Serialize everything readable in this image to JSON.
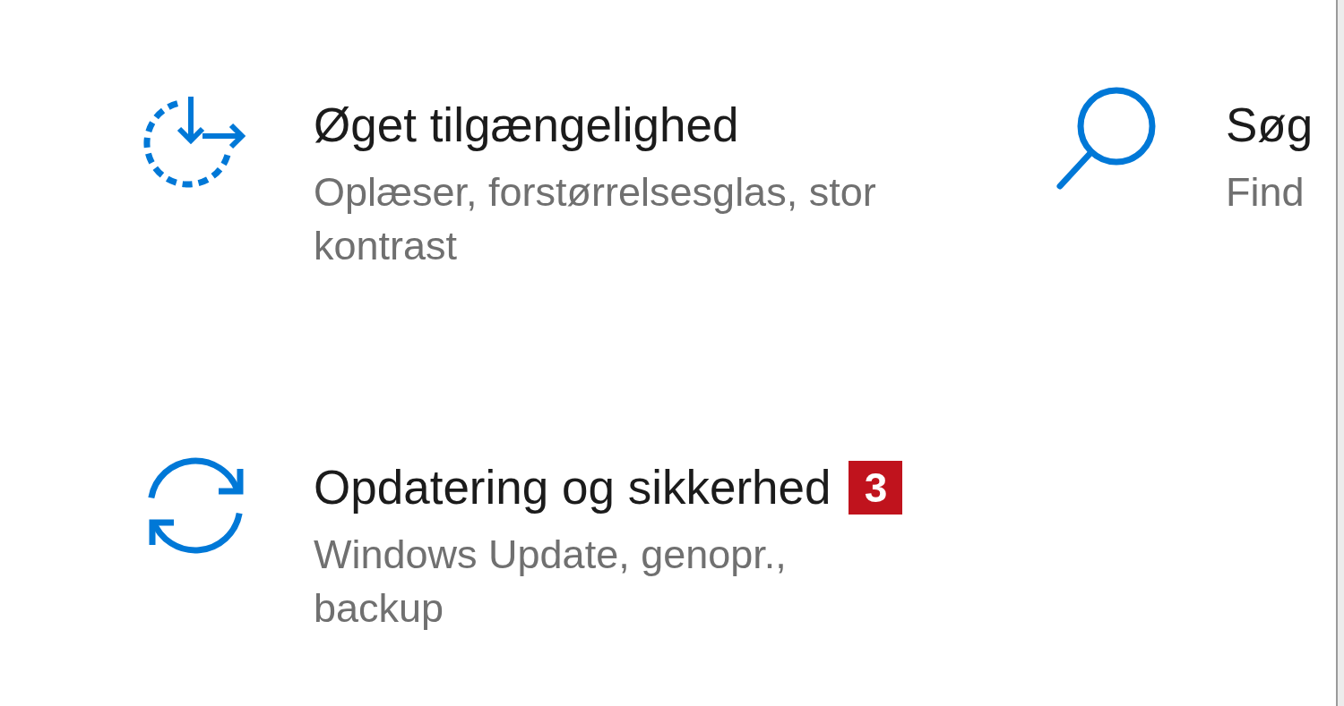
{
  "tiles": [
    {
      "title": "Øget tilgængelighed",
      "description": "Oplæser, forstørrelsesglas, stor kontrast"
    },
    {
      "title": "Søg",
      "description": "Find"
    },
    {
      "title": "Opdatering og sikkerhed",
      "badge": "3",
      "description": "Windows Update, genopr., backup"
    }
  ]
}
